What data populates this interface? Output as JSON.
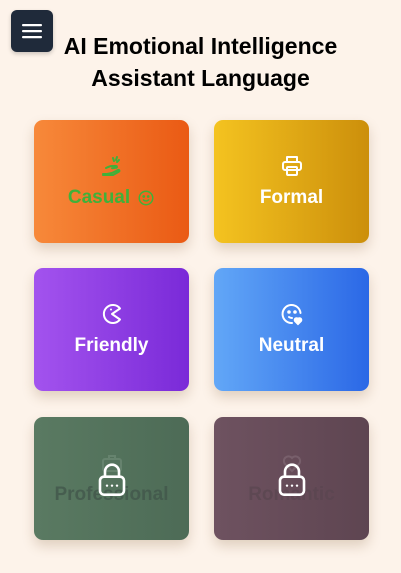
{
  "header": {
    "menu_icon": "hamburger-menu-icon",
    "title_line1": "AI Emotional Intelligence",
    "title_line2": "Assistant Language"
  },
  "cards": [
    {
      "label": "Casual",
      "icon": "hand-wave-icon",
      "badge_icon": "smiley-icon",
      "locked": false,
      "colors": [
        "#f7893a",
        "#ea5a14"
      ],
      "label_color": "#3fb13a"
    },
    {
      "label": "Formal",
      "icon": "printer-icon",
      "locked": false,
      "colors": [
        "#f4c320",
        "#cc8f0b"
      ]
    },
    {
      "label": "Friendly",
      "icon": "pacman-icon",
      "locked": false,
      "colors": [
        "#a353ee",
        "#7a2ad8"
      ]
    },
    {
      "label": "Neutral",
      "icon": "smiley-heart-icon",
      "locked": false,
      "colors": [
        "#62a7f7",
        "#2b68e6"
      ]
    },
    {
      "label": "Professional",
      "icon": "briefcase-icon",
      "locked": true,
      "lock_icon": "lock-icon",
      "colors": [
        "#5a7a62",
        "#4d6b56"
      ]
    },
    {
      "label": "Romantic",
      "icon": "heart-icon",
      "locked": true,
      "lock_icon": "lock-icon",
      "colors": [
        "#6e5260",
        "#5e4551"
      ]
    }
  ]
}
